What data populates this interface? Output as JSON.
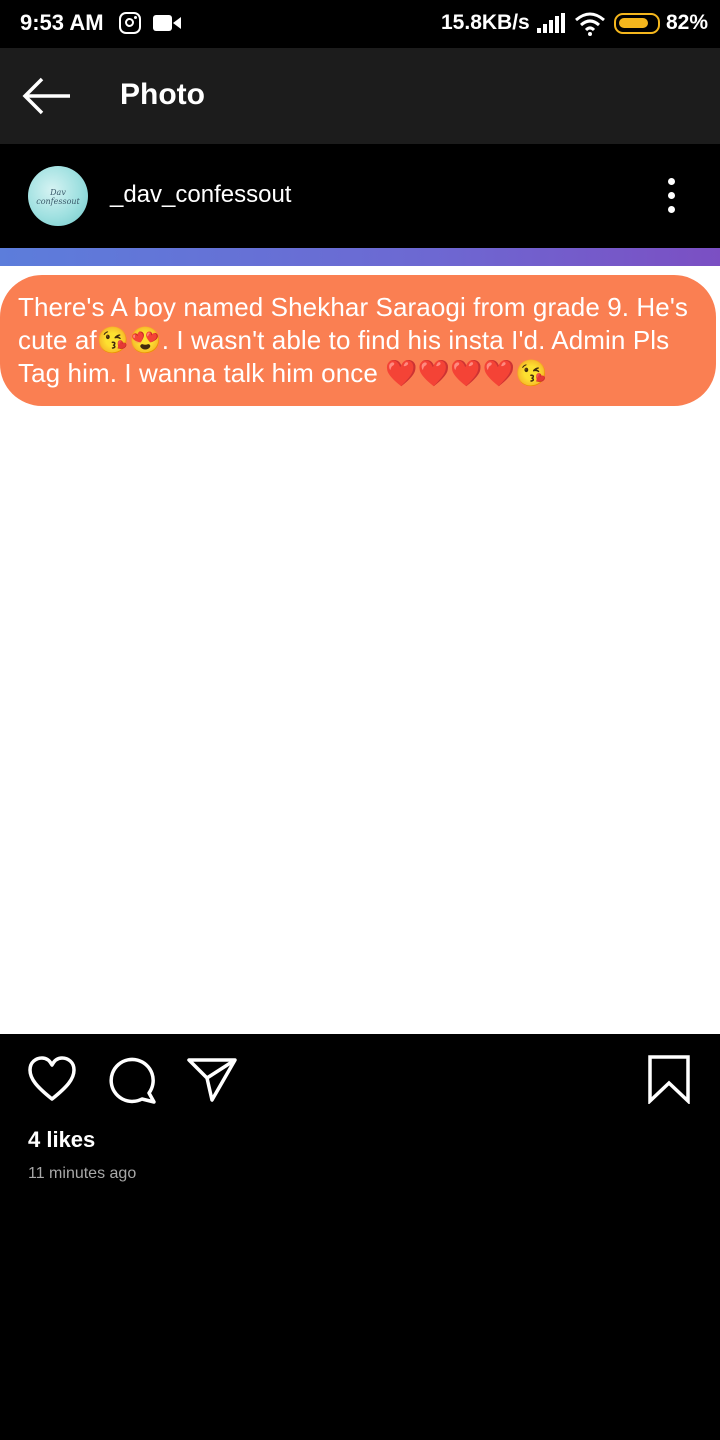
{
  "status_bar": {
    "time": "9:53 AM",
    "net_speed": "15.8KB/s",
    "battery_percent": "82%",
    "battery_level": 0.82,
    "icons": [
      "instagram-icon",
      "video-icon",
      "signal-icon",
      "wifi-icon",
      "battery-icon"
    ]
  },
  "app_bar": {
    "title": "Photo",
    "back_icon": "arrow-left-icon"
  },
  "post": {
    "username": "_dav_confessout",
    "avatar_text": "Dav confessout",
    "more_icon": "more-vertical-icon",
    "photo_text": "There's A boy named Shekhar Saraogi from grade 9. He's cute af😘😍. I wasn't able to find his insta I'd. Admin Pls Tag him. I wanna talk him once ❤️❤️❤️❤️😘",
    "bubble_color": "#fa7f52",
    "strip_colors": [
      "#5c7ddb",
      "#7b4fc3"
    ]
  },
  "actions": {
    "icons": [
      "heart-icon",
      "comment-icon",
      "share-icon",
      "bookmark-icon"
    ],
    "likes": "4 likes",
    "timestamp": "11 minutes ago"
  }
}
